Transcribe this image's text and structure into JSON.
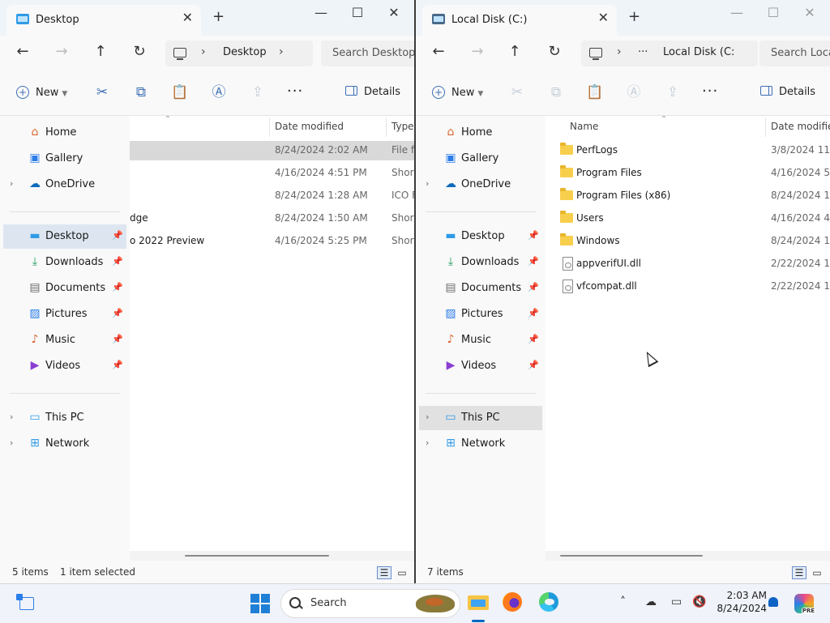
{
  "window1": {
    "tab_title": "Desktop",
    "breadcrumb": "Desktop",
    "search_placeholder": "Search Desktop",
    "toolbar": {
      "new_label": "New",
      "details_label": "Details"
    },
    "columns": {
      "date": "Date modified",
      "type": "Type"
    },
    "rows": [
      {
        "name": "",
        "date": "8/24/2024 2:02 AM",
        "type": "File fo",
        "selected": true
      },
      {
        "name": "",
        "date": "4/16/2024 4:51 PM",
        "type": "Short"
      },
      {
        "name": "",
        "date": "8/24/2024 1:28 AM",
        "type": "ICO F"
      },
      {
        "name": "dge",
        "date": "8/24/2024 1:50 AM",
        "type": "Short"
      },
      {
        "name": "o 2022 Preview",
        "date": "4/16/2024 5:25 PM",
        "type": "Short"
      }
    ],
    "status": {
      "items": "5 items",
      "selected": "1 item selected"
    }
  },
  "window2": {
    "tab_title": "Local Disk (C:)",
    "breadcrumb_more": "···",
    "breadcrumb": "Local Disk (C:",
    "search_placeholder": "Search Loca",
    "toolbar": {
      "new_label": "New",
      "details_label": "Details"
    },
    "columns": {
      "name": "Name",
      "date": "Date modified"
    },
    "rows": [
      {
        "name": "PerfLogs",
        "date": "3/8/2024 11:1",
        "kind": "folder"
      },
      {
        "name": "Program Files",
        "date": "4/16/2024 5:2",
        "kind": "folder"
      },
      {
        "name": "Program Files (x86)",
        "date": "8/24/2024 1:2",
        "kind": "folder"
      },
      {
        "name": "Users",
        "date": "4/16/2024 4:4",
        "kind": "folder"
      },
      {
        "name": "Windows",
        "date": "8/24/2024 1:1",
        "kind": "folder"
      },
      {
        "name": "appverifUI.dll",
        "date": "2/22/2024 12:",
        "kind": "dll"
      },
      {
        "name": "vfcompat.dll",
        "date": "2/22/2024 12:",
        "kind": "dll"
      }
    ],
    "status": {
      "items": "7 items"
    }
  },
  "sidebar": {
    "home": "Home",
    "gallery": "Gallery",
    "onedrive": "OneDrive",
    "desktop": "Desktop",
    "downloads": "Downloads",
    "documents": "Documents",
    "pictures": "Pictures",
    "music": "Music",
    "videos": "Videos",
    "thispc": "This PC",
    "network": "Network"
  },
  "taskbar": {
    "search_label": "Search",
    "time": "2:03 AM",
    "date": "8/24/2024",
    "copilot_badge": "PRE"
  },
  "colors": {
    "accent": "#0067c0",
    "selection": "#dde6f0",
    "folder": "#f8cf4d"
  }
}
